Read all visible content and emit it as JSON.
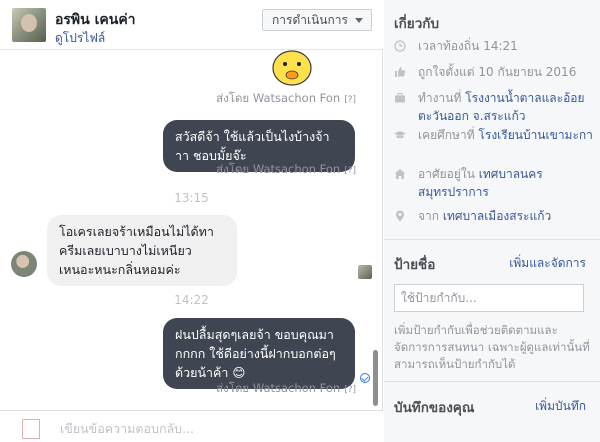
{
  "header": {
    "contact_name": "อรพิน เคนค่า",
    "profile_link": "ดูโปรไฟล์",
    "actions_label": "การดำเนินการ"
  },
  "messages": {
    "sentby_1": "ส่งโดย Watsachon Fon",
    "bubble_1": "สวัสดีจ้า ใช้แล้วเป็นไงบ้างจ้าาา ชอบมั้ยจ๊ะ",
    "sentby_2": "ส่งโดย Watsachon Fon",
    "time_1": "13:15",
    "bubble_in": "โอเครเลยจร้าเหมือนไม่ได้ทาครีมเลยเบาบางไม่เหนียวเหนอะหนะกลิ่นหอมค่ะ",
    "time_2": "14:22",
    "bubble_3": "ฝนปลื้มสุดๆเลยจ้า ขอบคุณมากกกก ใช้ดีอย่างนี้ฝากบอกต่อๆด้วยน้าค้า 😊",
    "sentby_3": "ส่งโดย Watsachon Fon",
    "qmark": "[?]"
  },
  "composer": {
    "placeholder": "เขียนข้อความตอบกลับ..."
  },
  "about": {
    "title": "เกี่ยวกับ",
    "local_time": "เวลาท้องถิ่น 14:21",
    "liked_since": "ถูกใจตั้งแต่ 10 กันยายน 2016",
    "works_prefix": "ทำงานที่ ",
    "works_at": "โรงงานน้ำตาลและอ้อยตะวันออก จ.สระแก้ว",
    "studied_prefix": "เคยศึกษาที่ ",
    "studied_at": "โรงเรียนบ้านเขามะกา",
    "lives_prefix": "อาศัยอยู่ใน ",
    "lives_in": "เทศบาลนครสมุทรปราการ",
    "from_prefix": "จาก ",
    "from": "เทศบาลเมืองสระแก้ว"
  },
  "tags": {
    "title": "ป้ายชื่อ",
    "manage_link": "เพิ่มและจัดการ",
    "input_placeholder": "ใช้ป้ายกำกับ...",
    "description": "เพิ่มป้ายกำกับเพื่อช่วยติดตามและจัดการการสนทนา เฉพาะผู้ดูแลเท่านั้นที่สามารถเห็นป้ายกำกับได้"
  },
  "notes": {
    "title": "บันทึกของคุณ",
    "add_link": "เพิ่มบันทึก"
  },
  "colors": {
    "outgoing_bubble": "#3f4551",
    "incoming_bubble": "#f1f0f0",
    "link": "#365899",
    "sidebar_bg": "#f6f7f9"
  }
}
